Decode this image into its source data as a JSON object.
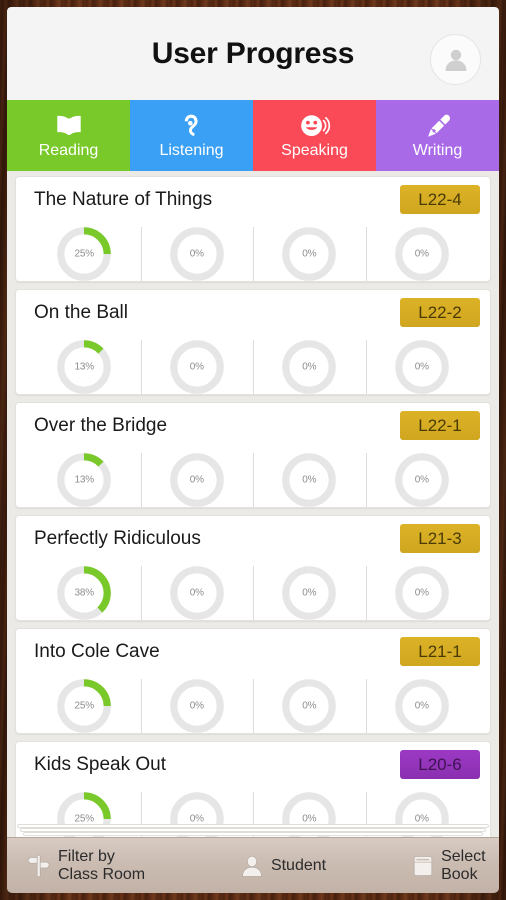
{
  "header": {
    "title": "User Progress",
    "avatar_icon": "user-avatar-icon"
  },
  "tabs": [
    {
      "label": "Reading",
      "icon": "open-book-icon",
      "color": "#7ac92b",
      "active": true
    },
    {
      "label": "Listening",
      "icon": "ear-icon",
      "color": "#3aa0f5",
      "active": false
    },
    {
      "label": "Speaking",
      "icon": "smiley-sound-icon",
      "color": "#fb4a57",
      "active": false
    },
    {
      "label": "Writing",
      "icon": "fountain-pen-icon",
      "color": "#a96ae8",
      "active": false
    }
  ],
  "colors": {
    "progress_green": "#7ac92b",
    "track_gray": "#e6e6e6",
    "badge_gold_bg": "#cfa61f",
    "badge_gold_text": "#4a3b06",
    "badge_purple_bg": "#9c39c4",
    "badge_purple_text": "#3f1254",
    "wood_border": "#4a2412"
  },
  "books": [
    {
      "title": "The Nature of Things",
      "level": "L22-4",
      "badge_style": "gold",
      "progress": [
        {
          "skill": "Reading",
          "percent": 25,
          "label": "25%"
        },
        {
          "skill": "Listening",
          "percent": 0,
          "label": "0%"
        },
        {
          "skill": "Speaking",
          "percent": 0,
          "label": "0%"
        },
        {
          "skill": "Writing",
          "percent": 0,
          "label": "0%"
        }
      ]
    },
    {
      "title": "On the Ball",
      "level": "L22-2",
      "badge_style": "gold",
      "progress": [
        {
          "skill": "Reading",
          "percent": 13,
          "label": "13%"
        },
        {
          "skill": "Listening",
          "percent": 0,
          "label": "0%"
        },
        {
          "skill": "Speaking",
          "percent": 0,
          "label": "0%"
        },
        {
          "skill": "Writing",
          "percent": 0,
          "label": "0%"
        }
      ]
    },
    {
      "title": "Over the Bridge",
      "level": "L22-1",
      "badge_style": "gold",
      "progress": [
        {
          "skill": "Reading",
          "percent": 13,
          "label": "13%"
        },
        {
          "skill": "Listening",
          "percent": 0,
          "label": "0%"
        },
        {
          "skill": "Speaking",
          "percent": 0,
          "label": "0%"
        },
        {
          "skill": "Writing",
          "percent": 0,
          "label": "0%"
        }
      ]
    },
    {
      "title": "Perfectly Ridiculous",
      "level": "L21-3",
      "badge_style": "gold",
      "progress": [
        {
          "skill": "Reading",
          "percent": 38,
          "label": "38%"
        },
        {
          "skill": "Listening",
          "percent": 0,
          "label": "0%"
        },
        {
          "skill": "Speaking",
          "percent": 0,
          "label": "0%"
        },
        {
          "skill": "Writing",
          "percent": 0,
          "label": "0%"
        }
      ]
    },
    {
      "title": "Into Cole Cave",
      "level": "L21-1",
      "badge_style": "gold",
      "progress": [
        {
          "skill": "Reading",
          "percent": 25,
          "label": "25%"
        },
        {
          "skill": "Listening",
          "percent": 0,
          "label": "0%"
        },
        {
          "skill": "Speaking",
          "percent": 0,
          "label": "0%"
        },
        {
          "skill": "Writing",
          "percent": 0,
          "label": "0%"
        }
      ]
    },
    {
      "title": "Kids Speak Out",
      "level": "L20-6",
      "badge_style": "purple",
      "progress": [
        {
          "skill": "Reading",
          "percent": 25,
          "label": "25%"
        },
        {
          "skill": "Listening",
          "percent": 0,
          "label": "0%"
        },
        {
          "skill": "Speaking",
          "percent": 0,
          "label": "0%"
        },
        {
          "skill": "Writing",
          "percent": 0,
          "label": "0%"
        }
      ]
    }
  ],
  "toolbar": [
    {
      "label": "Filter by Class Room",
      "icon": "signpost-icon"
    },
    {
      "label": "Student",
      "icon": "student-icon"
    },
    {
      "label": "Select Book",
      "icon": "book-icon"
    }
  ]
}
